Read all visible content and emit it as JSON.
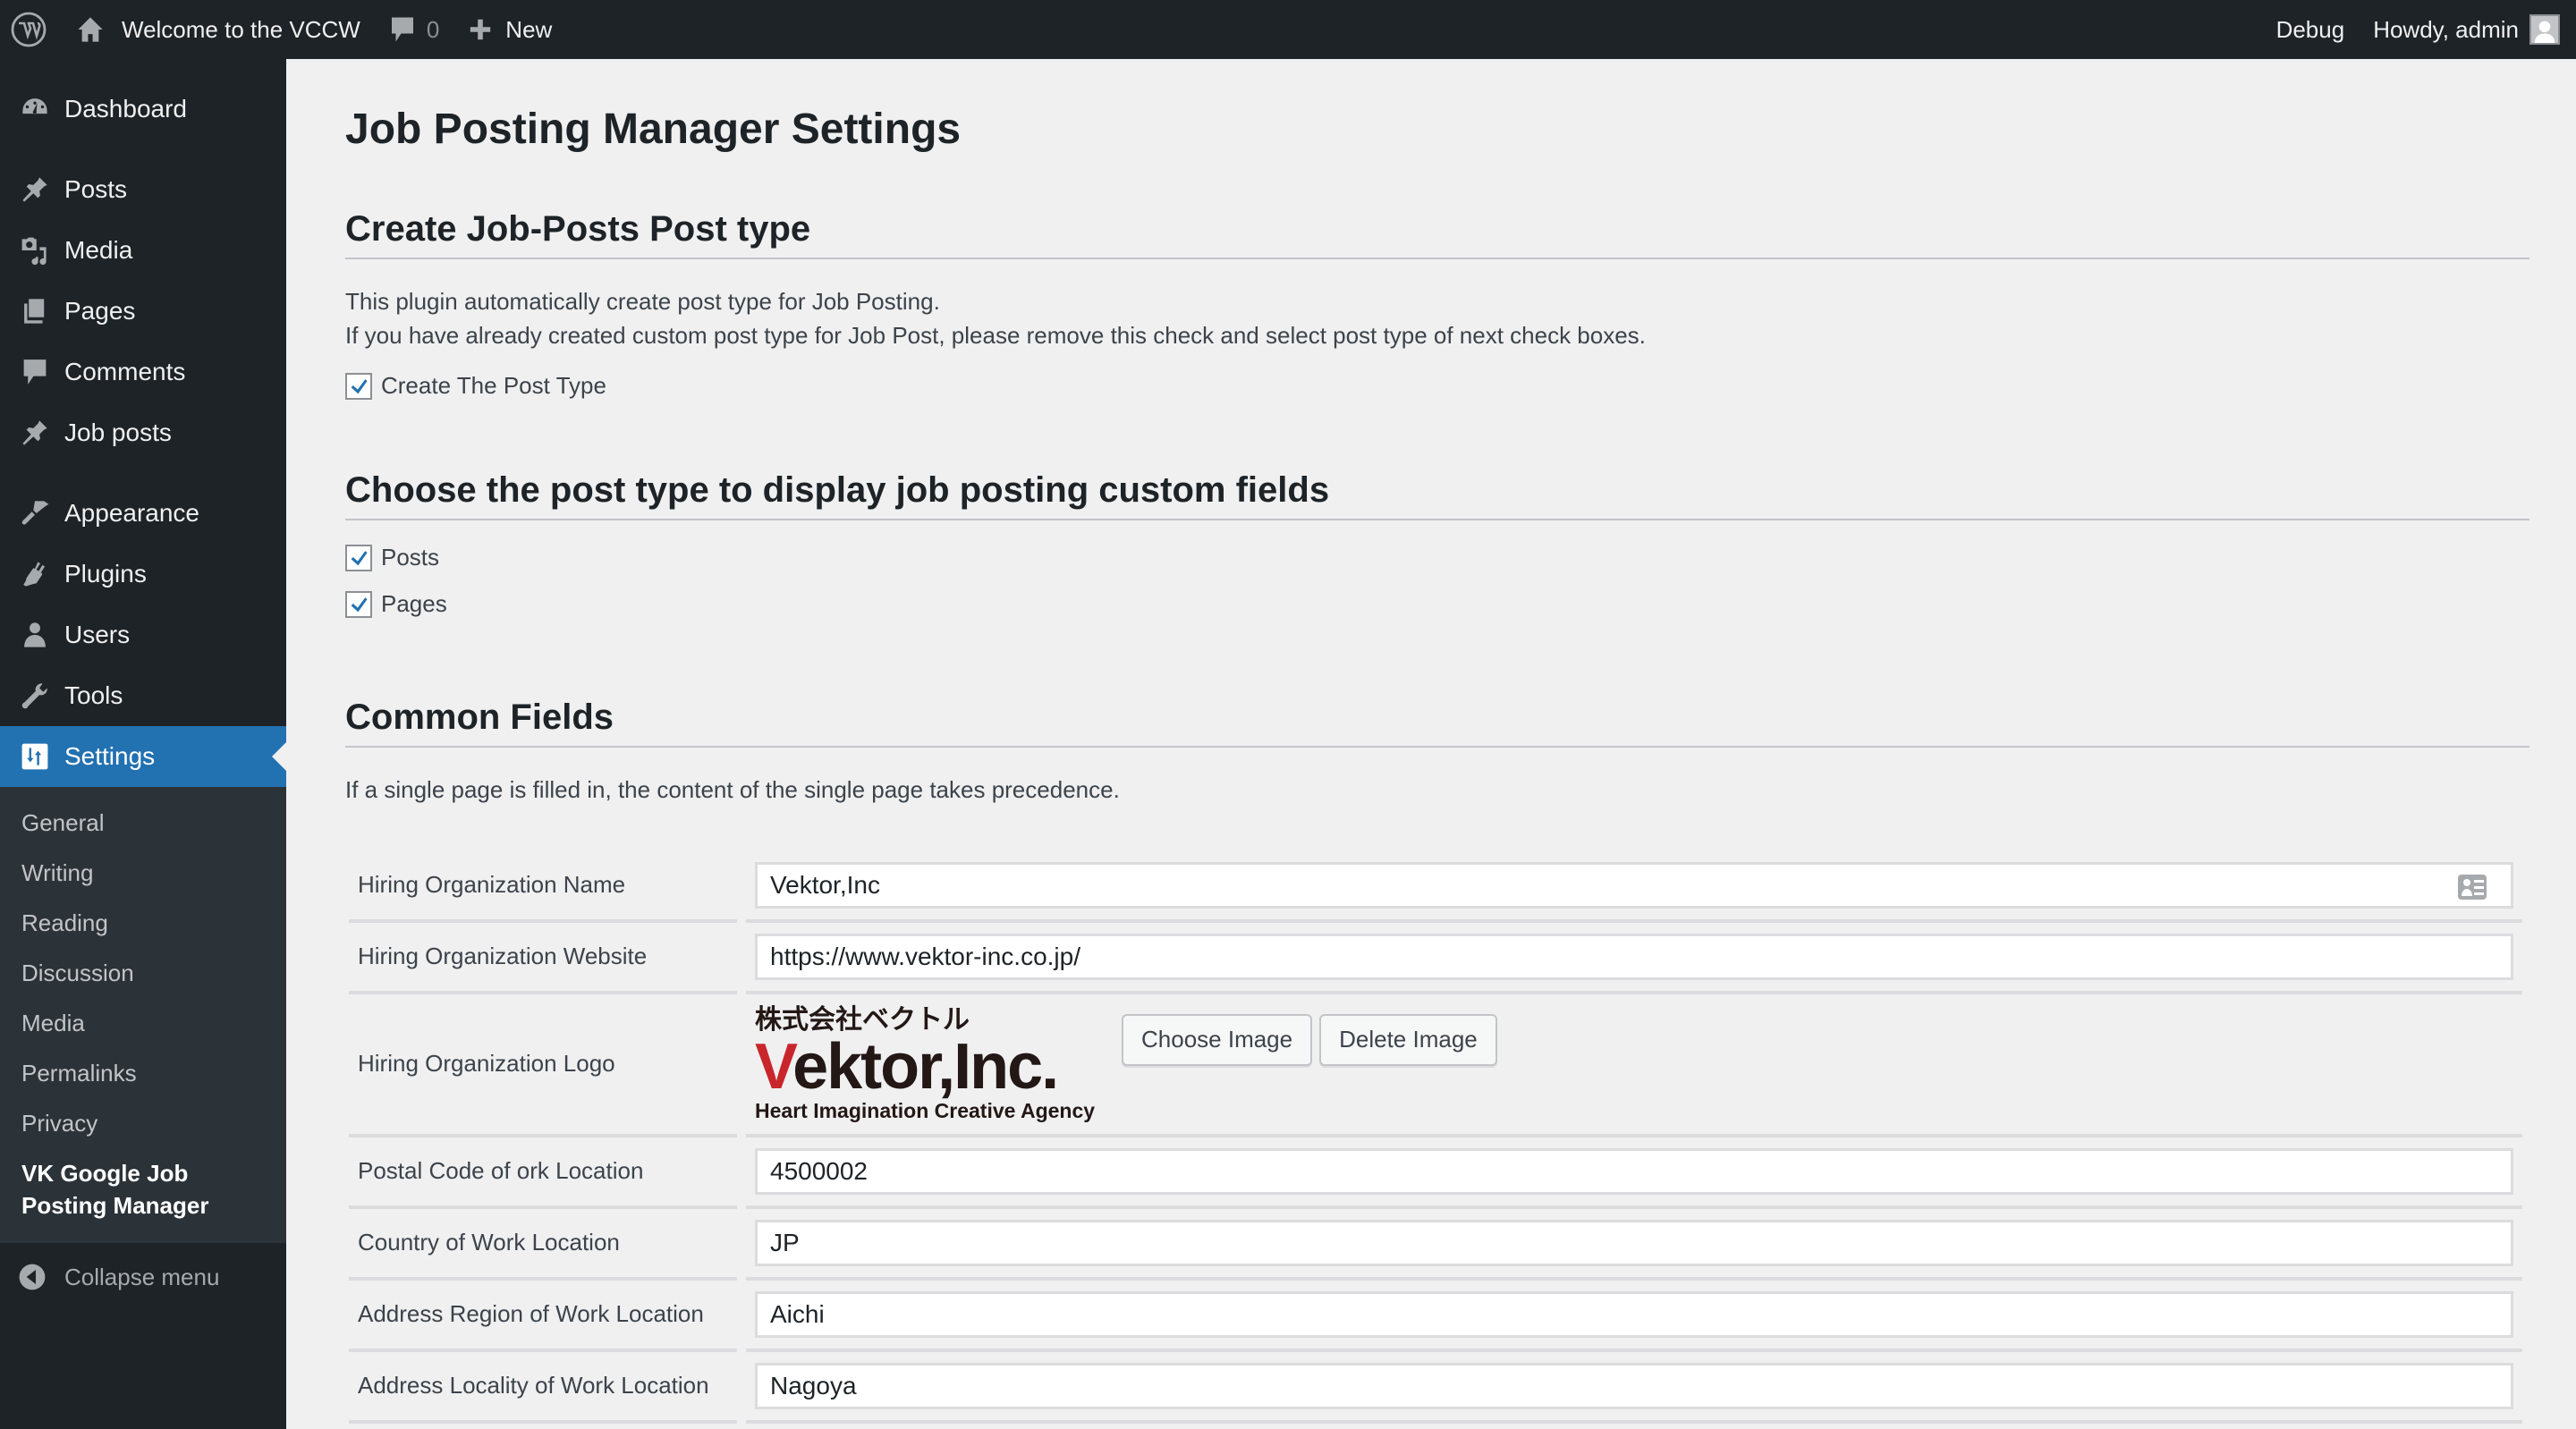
{
  "admin_bar": {
    "site_name": "Welcome to the VCCW",
    "comments_count": "0",
    "new_label": "New",
    "debug_label": "Debug",
    "greeting": "Howdy, admin"
  },
  "sidebar": {
    "menu": [
      {
        "label": "Dashboard",
        "icon": "dashboard-icon"
      },
      {
        "label": "Posts",
        "icon": "pin-icon"
      },
      {
        "label": "Media",
        "icon": "media-icon"
      },
      {
        "label": "Pages",
        "icon": "pages-icon"
      },
      {
        "label": "Comments",
        "icon": "comment-icon"
      },
      {
        "label": "Job posts",
        "icon": "pin-icon"
      },
      {
        "label": "Appearance",
        "icon": "paintbrush-icon"
      },
      {
        "label": "Plugins",
        "icon": "plugin-icon"
      },
      {
        "label": "Users",
        "icon": "user-icon"
      },
      {
        "label": "Tools",
        "icon": "wrench-icon"
      },
      {
        "label": "Settings",
        "icon": "settings-icon",
        "current": true
      }
    ],
    "submenu": [
      {
        "label": "General"
      },
      {
        "label": "Writing"
      },
      {
        "label": "Reading"
      },
      {
        "label": "Discussion"
      },
      {
        "label": "Media"
      },
      {
        "label": "Permalinks"
      },
      {
        "label": "Privacy"
      },
      {
        "label": "VK Google Job Posting Manager",
        "current": true
      }
    ],
    "collapse_label": "Collapse menu"
  },
  "main": {
    "page_title": "Job Posting Manager Settings",
    "section1": {
      "title": "Create Job-Posts Post type",
      "desc_line1": "This plugin automatically create post type for Job Posting.",
      "desc_line2": "If you have already created custom post type for Job Post, please remove this check and select post type of next check boxes.",
      "checkbox_label": "Create The Post Type",
      "checked": true
    },
    "section2": {
      "title": "Choose the post type to display job posting custom fields",
      "options": [
        {
          "label": "Posts",
          "checked": true
        },
        {
          "label": "Pages",
          "checked": true
        }
      ]
    },
    "section3": {
      "title": "Common Fields",
      "desc": "If a single page is filled in, the content of the single page takes precedence.",
      "fields": {
        "org_name": {
          "label": "Hiring Organization Name",
          "value": "Vektor,Inc"
        },
        "org_website": {
          "label": "Hiring Organization Website",
          "value": "https://www.vektor-inc.co.jp/"
        },
        "org_logo": {
          "label": "Hiring Organization Logo",
          "logo_jp": "株式会社ベクトル",
          "logo_brand_first": "V",
          "logo_brand_rest": "ektor,Inc.",
          "logo_tagline": "Heart Imagination Creative Agency",
          "choose_label": "Choose Image",
          "delete_label": "Delete Image"
        },
        "postal_code": {
          "label": "Postal Code of ork Location",
          "value": "4500002"
        },
        "country": {
          "label": "Country of Work Location",
          "value": "JP"
        },
        "region": {
          "label": "Address Region of Work Location",
          "value": "Aichi"
        },
        "locality": {
          "label": "Address Locality of Work Location",
          "value": "Nagoya"
        }
      }
    }
  },
  "colors": {
    "admin_bar_bg": "#1d2327",
    "accent": "#2271b1",
    "submenu_bg": "#2c3338",
    "page_bg": "#f0f0f1",
    "logo_red": "#c8262b"
  }
}
